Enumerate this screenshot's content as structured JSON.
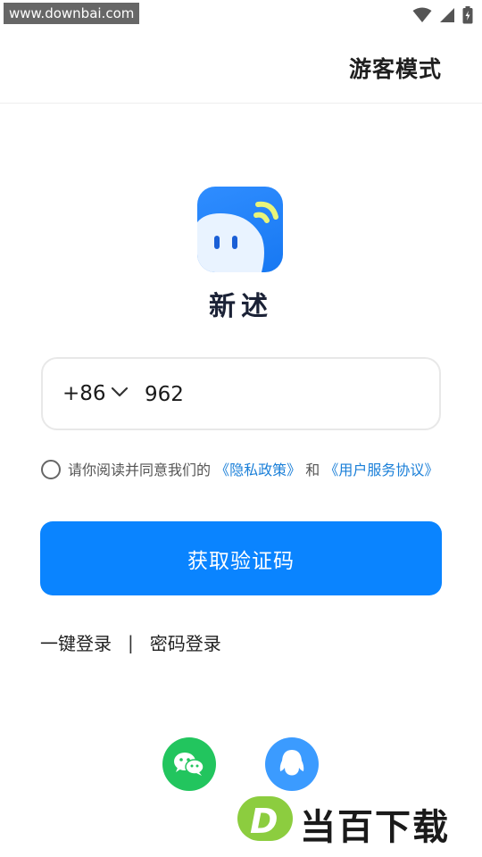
{
  "statusbar": {
    "watermark": "www.downbai.com",
    "icons": [
      "wifi-icon",
      "signal-icon",
      "battery-icon"
    ]
  },
  "header": {
    "guest_mode": "游客模式"
  },
  "app": {
    "name": "新述",
    "brand_color": "#0a84ff"
  },
  "login": {
    "country_code": "+86",
    "phone_value": "962",
    "agree_prefix": "请你阅读并同意我们的",
    "privacy_link": "《隐私政策》",
    "and": "和",
    "terms_link": "《用户服务协议》",
    "get_code_button": "获取验证码",
    "one_click_login": "一键登录",
    "divider": "|",
    "password_login": "密码登录"
  },
  "social": [
    "wechat-icon",
    "qq-icon"
  ],
  "bottom_watermark": {
    "badge_letter": "D",
    "text": "当百下载"
  }
}
